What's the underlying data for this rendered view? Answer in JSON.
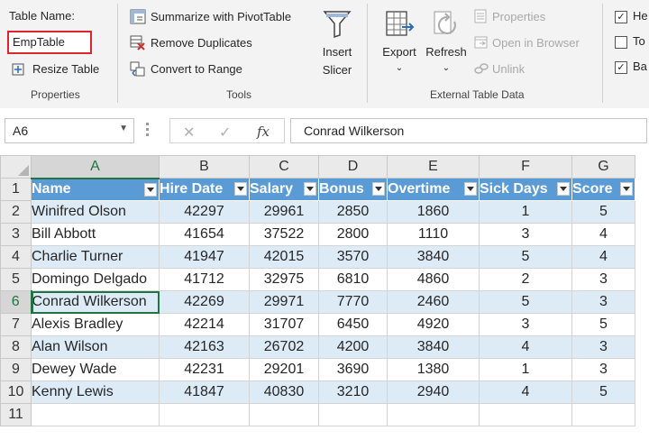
{
  "ribbon": {
    "properties": {
      "table_name_label": "Table Name:",
      "table_name_value": "EmpTable",
      "resize_label": "Resize Table",
      "group_label": "Properties"
    },
    "tools": {
      "summarize_label": "Summarize with PivotTable",
      "remove_dup_label": "Remove Duplicates",
      "convert_label": "Convert to Range",
      "insert_slicer_line1": "Insert",
      "insert_slicer_line2": "Slicer",
      "group_label": "Tools"
    },
    "external": {
      "export_label": "Export",
      "refresh_label": "Refresh",
      "properties_label": "Properties",
      "open_browser_label": "Open in Browser",
      "unlink_label": "Unlink",
      "group_label": "External Table Data"
    },
    "style_options": [
      {
        "label": "He",
        "checked": true
      },
      {
        "label": "To",
        "checked": false
      },
      {
        "label": "Ba",
        "checked": true
      }
    ]
  },
  "formula_bar": {
    "name_box": "A6",
    "cancel_glyph": "✕",
    "enter_glyph": "✓",
    "fx_glyph": "fx",
    "content": "Conrad Wilkerson"
  },
  "sheet": {
    "columns": [
      "A",
      "B",
      "C",
      "D",
      "E",
      "F",
      "G"
    ],
    "headers": [
      "Name",
      "Hire Date",
      "Salary",
      "Bonus",
      "Overtime",
      "Sick Days",
      "Score"
    ],
    "rows": [
      [
        "Winifred Olson",
        "42297",
        "29961",
        "2850",
        "1860",
        "1",
        "5"
      ],
      [
        "Bill Abbott",
        "41654",
        "37522",
        "2800",
        "1110",
        "3",
        "4"
      ],
      [
        "Charlie Turner",
        "41947",
        "42015",
        "3570",
        "3840",
        "5",
        "4"
      ],
      [
        "Domingo Delgado",
        "41712",
        "32975",
        "6810",
        "4860",
        "2",
        "3"
      ],
      [
        "Conrad Wilkerson",
        "42269",
        "29971",
        "7770",
        "2460",
        "5",
        "3"
      ],
      [
        "Alexis Bradley",
        "42214",
        "31707",
        "6450",
        "4920",
        "3",
        "5"
      ],
      [
        "Alan Wilson",
        "42163",
        "26702",
        "4200",
        "3840",
        "4",
        "3"
      ],
      [
        "Dewey Wade",
        "42231",
        "29201",
        "3690",
        "1380",
        "1",
        "3"
      ],
      [
        "Kenny Lewis",
        "41847",
        "40830",
        "3210",
        "2940",
        "4",
        "5"
      ]
    ],
    "row_numbers": [
      "1",
      "2",
      "3",
      "4",
      "5",
      "6",
      "7",
      "8",
      "9",
      "10",
      "11"
    ],
    "active_cell": "A6"
  },
  "colors": {
    "header_fill": "#5b9bd5",
    "band_fill": "#ddebf7",
    "selection": "#217346",
    "name_highlight": "#e0242d"
  }
}
